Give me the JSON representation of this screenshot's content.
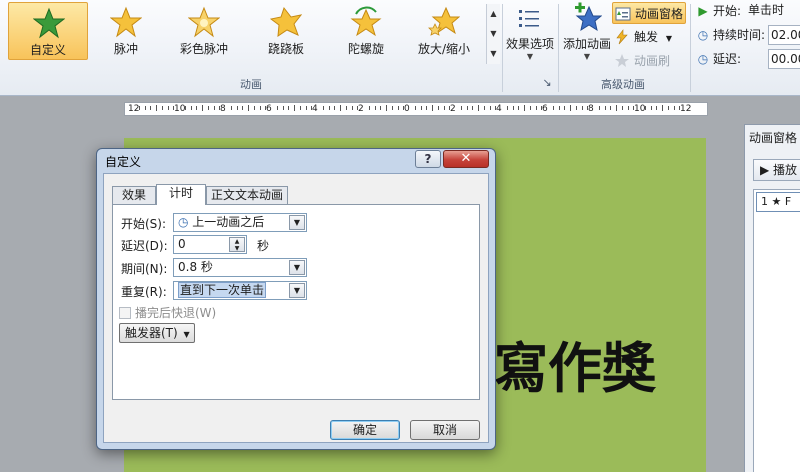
{
  "ribbon": {
    "effects": [
      {
        "label": "自定义",
        "icon": "star-custom-icon",
        "color": "#3a9a3a",
        "selected": true
      },
      {
        "label": "脉冲",
        "icon": "star-pulse-icon",
        "color": "#f0b428"
      },
      {
        "label": "彩色脉冲",
        "icon": "star-color-pulse-icon",
        "color": "#f0b428"
      },
      {
        "label": "跷跷板",
        "icon": "star-teeter-icon",
        "color": "#f0b428"
      },
      {
        "label": "陀螺旋",
        "icon": "star-spin-icon",
        "color": "#f0b428"
      },
      {
        "label": "放大/缩小",
        "icon": "star-grow-shrink-icon",
        "color": "#f0b428"
      }
    ],
    "effect_options_label": "效果选项",
    "animation_group_label": "动画",
    "add_animation_label": "添加动画",
    "animation_pane_label": "动画窗格",
    "trigger_label": "触发",
    "animation_painter_label": "动画刷",
    "advanced_group_label": "高级动画",
    "timing": {
      "start_label": "开始:",
      "start_value": "单击时",
      "duration_label": "持续时间:",
      "duration_value": "02.00",
      "delay_label": "延迟:",
      "delay_value": "00.00"
    }
  },
  "ruler": {
    "numbers": [
      "12",
      "10",
      "8",
      "6",
      "4",
      "2",
      "0",
      "2",
      "4",
      "6",
      "8",
      "10",
      "12"
    ]
  },
  "slide": {
    "background": "#9bbb59",
    "text": "寫作獎"
  },
  "animation_pane": {
    "title": "动画窗格",
    "play_label": "▶ 播放",
    "item_label": "1 ★ F"
  },
  "dialog": {
    "title": "自定义",
    "help": "?",
    "close": "✕",
    "tabs": [
      "效果",
      "计时",
      "正文文本动画"
    ],
    "start_label": "开始(S):",
    "start_value": "上一动画之后",
    "delay_label": "延迟(D):",
    "delay_value": "0",
    "delay_unit": "秒",
    "period_label": "期间(N):",
    "period_value": "0.8 秒",
    "repeat_label": "重复(R):",
    "repeat_value": "直到下一次单击",
    "rewind_label": "播完后快退(W)",
    "trigger_label": "触发器(T)",
    "ok_label": "确定",
    "cancel_label": "取消"
  }
}
